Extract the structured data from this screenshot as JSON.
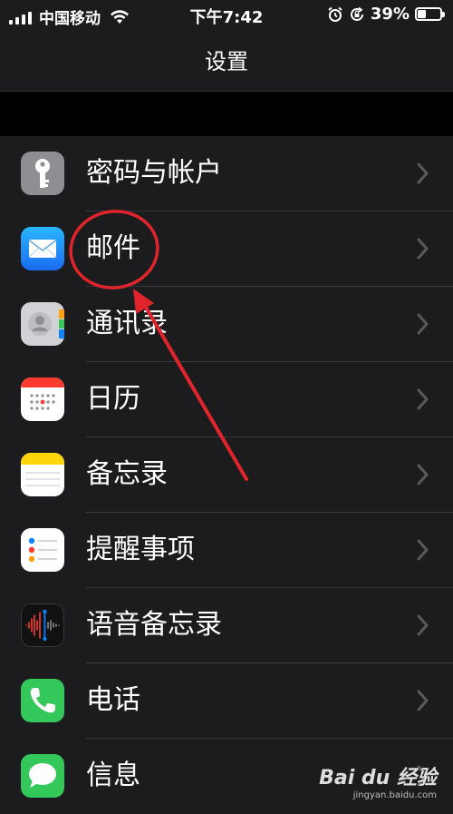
{
  "status_bar": {
    "carrier": "中国移动",
    "time": "下午7:42",
    "battery_percent": "39%",
    "battery_level": 0.39
  },
  "nav": {
    "title": "设置"
  },
  "items": [
    {
      "label": "密码与帐户",
      "icon": "key-icon",
      "color": "#8e8e93"
    },
    {
      "label": "邮件",
      "icon": "mail-icon",
      "color": "#1a8cff"
    },
    {
      "label": "通讯录",
      "icon": "contacts-icon",
      "color": "#c7c7c7"
    },
    {
      "label": "日历",
      "icon": "calendar-icon",
      "color": "#ffffff"
    },
    {
      "label": "备忘录",
      "icon": "notes-icon",
      "color": "#ffd60a"
    },
    {
      "label": "提醒事项",
      "icon": "reminders-icon",
      "color": "#ffffff"
    },
    {
      "label": "语音备忘录",
      "icon": "voice-memos-icon",
      "color": "#1c1c1e"
    },
    {
      "label": "电话",
      "icon": "phone-icon",
      "color": "#34c759"
    },
    {
      "label": "信息",
      "icon": "messages-icon",
      "color": "#34c759"
    }
  ],
  "annotation": {
    "highlight_color": "#e0242b"
  },
  "watermark": {
    "logo": "Bai du 经验",
    "url": "jingyan.baidu.com"
  }
}
